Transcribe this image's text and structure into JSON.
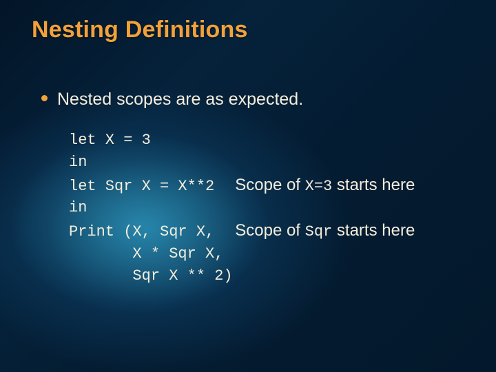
{
  "title": "Nesting Definitions",
  "bullet": "Nested scopes are as expected.",
  "code": {
    "l1": "let X = 3",
    "l2": "in",
    "l3": "let Sqr X = X**2",
    "l4": "in",
    "l5": "Print (X, Sqr X,",
    "l6": "       X * Sqr X,",
    "l7": "       Sqr X ** 2)"
  },
  "annot": {
    "a1_pre": "Scope of ",
    "a1_code": "X=3",
    "a1_post": " starts here",
    "a2_pre": "Scope of ",
    "a2_code": "Sqr",
    "a2_post": " starts here"
  }
}
